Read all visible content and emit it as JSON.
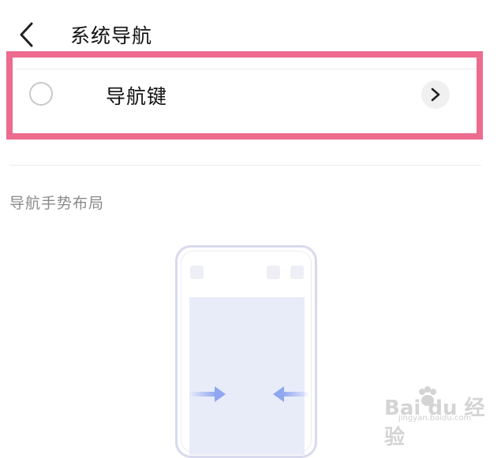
{
  "header": {
    "back_icon": "chevron-left-icon",
    "title": "系统导航"
  },
  "options": [
    {
      "label": "导航键",
      "selected": false,
      "radio_icon": "radio-unselected-icon",
      "action_icon": "chevron-right-icon"
    }
  ],
  "section": {
    "title": "导航手势布局"
  },
  "illustration": {
    "icon": "phone-gesture-illustration-icon",
    "left_arrow_icon": "arrow-right-icon",
    "right_arrow_icon": "arrow-left-icon"
  },
  "watermark": {
    "brand": "Bai du 经验",
    "domain": "jingyan.baidu.com"
  },
  "colors": {
    "highlight": "#ec6b8e",
    "background": "#ffffff",
    "text_primary": "#111111",
    "text_secondary": "#8a8a8a",
    "illustration_screen": "#e8ecf9",
    "arrow": "#8fa6f0"
  }
}
